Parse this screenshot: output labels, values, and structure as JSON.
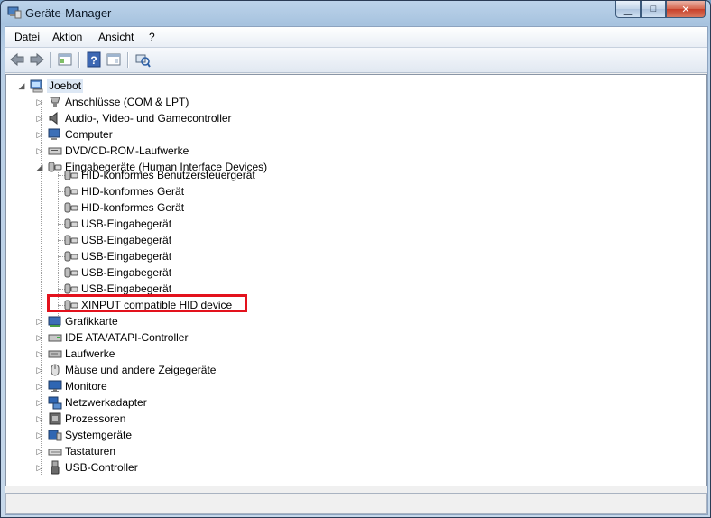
{
  "window": {
    "title": "Geräte-Manager"
  },
  "window_buttons": {
    "minimize": "▁",
    "maximize": "□",
    "close": "✕"
  },
  "menu": [
    "Datei",
    "Aktion",
    "Ansicht",
    "?"
  ],
  "toolbar": [
    "back-icon",
    "forward-icon",
    "properties-pane-icon",
    "help-icon",
    "view-icon",
    "scan-hardware-icon"
  ],
  "tree": {
    "root": "Joebot",
    "categories": [
      {
        "label": "Anschlüsse (COM & LPT)",
        "expander": "▷",
        "icon": "port-icon"
      },
      {
        "label": "Audio-, Video- und Gamecontroller",
        "expander": "▷",
        "icon": "speaker-icon"
      },
      {
        "label": "Computer",
        "expander": "▷",
        "icon": "computer-icon"
      },
      {
        "label": "DVD/CD-ROM-Laufwerke",
        "expander": "▷",
        "icon": "dvd-icon"
      },
      {
        "label": "Eingabegeräte (Human Interface Devices)",
        "expander": "◢",
        "icon": "hid-icon"
      }
    ],
    "hid_children": [
      "HID-konformes Benutzersteuergerät",
      "HID-konformes Gerät",
      "HID-konformes Gerät",
      "USB-Eingabegerät",
      "USB-Eingabegerät",
      "USB-Eingabegerät",
      "USB-Eingabegerät",
      "USB-Eingabegerät",
      "XINPUT compatible HID device"
    ],
    "categories_after": [
      {
        "label": "Grafikkarte",
        "expander": "▷",
        "icon": "display-adapter-icon"
      },
      {
        "label": "IDE ATA/ATAPI-Controller",
        "expander": "▷",
        "icon": "ide-controller-icon"
      },
      {
        "label": "Laufwerke",
        "expander": "▷",
        "icon": "disk-drive-icon"
      },
      {
        "label": "Mäuse und andere Zeigegeräte",
        "expander": "▷",
        "icon": "mouse-icon"
      },
      {
        "label": "Monitore",
        "expander": "▷",
        "icon": "monitor-icon"
      },
      {
        "label": "Netzwerkadapter",
        "expander": "▷",
        "icon": "network-adapter-icon"
      },
      {
        "label": "Prozessoren",
        "expander": "▷",
        "icon": "processor-icon"
      },
      {
        "label": "Systemgeräte",
        "expander": "▷",
        "icon": "system-devices-icon"
      },
      {
        "label": "Tastaturen",
        "expander": "▷",
        "icon": "keyboard-icon"
      },
      {
        "label": "USB-Controller",
        "expander": "▷",
        "icon": "usb-controller-icon"
      }
    ],
    "highlighted_item": "XINPUT compatible HID device",
    "highlight_color": "#e3121d"
  }
}
